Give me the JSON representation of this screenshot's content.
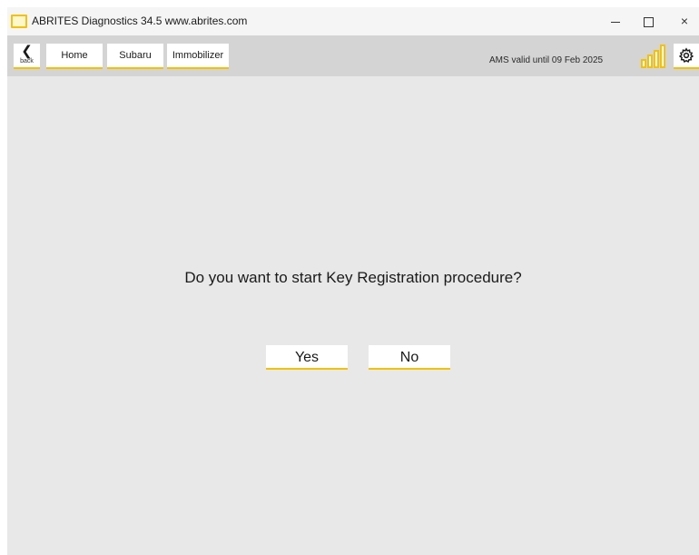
{
  "window": {
    "title": "ABRITES Diagnostics 34.5   www.abrites.com",
    "controls": {
      "minimize": "minimize",
      "maximize": "maximize",
      "close": "×"
    }
  },
  "nav": {
    "back_label": "back",
    "back_glyph": "❮",
    "breadcrumbs": [
      "Home",
      "Subaru",
      "Immobilizer"
    ],
    "ams_status": "AMS valid until 09 Feb 2025",
    "signal_icon": "signal-bars-icon",
    "settings_icon": "gear-icon"
  },
  "dialog": {
    "question": "Do you want to start Key Registration procedure?",
    "yes_label": "Yes",
    "no_label": "No"
  },
  "colors": {
    "accent": "#f2c100",
    "background": "#e8e8e8",
    "toolbar": "#d4d4d4"
  }
}
